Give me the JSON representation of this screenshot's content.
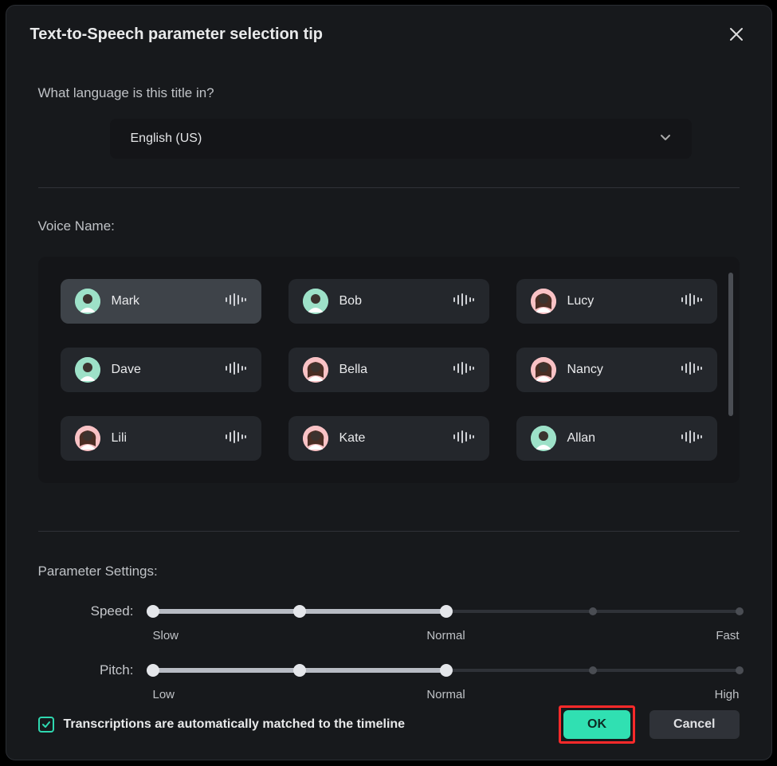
{
  "dialog": {
    "title": "Text-to-Speech parameter selection tip",
    "close_icon": "close"
  },
  "language": {
    "label": "What language is this title in?",
    "selected": "English (US)"
  },
  "voice": {
    "label": "Voice Name:",
    "selected_index": 0,
    "items": [
      {
        "name": "Mark",
        "avatar_color": "green",
        "gender": "m"
      },
      {
        "name": "Bob",
        "avatar_color": "green",
        "gender": "m"
      },
      {
        "name": "Lucy",
        "avatar_color": "pink",
        "gender": "f"
      },
      {
        "name": "Dave",
        "avatar_color": "green",
        "gender": "m"
      },
      {
        "name": "Bella",
        "avatar_color": "pink",
        "gender": "f"
      },
      {
        "name": "Nancy",
        "avatar_color": "pink",
        "gender": "f"
      },
      {
        "name": "Lili",
        "avatar_color": "pink",
        "gender": "f"
      },
      {
        "name": "Kate",
        "avatar_color": "pink",
        "gender": "f"
      },
      {
        "name": "Allan",
        "avatar_color": "green",
        "gender": "m"
      }
    ]
  },
  "parameters": {
    "label": "Parameter Settings:",
    "speed": {
      "name": "Speed:",
      "value": 50,
      "ticks": [
        "Slow",
        "Normal",
        "Fast"
      ]
    },
    "pitch": {
      "name": "Pitch:",
      "value": 50,
      "ticks": [
        "Low",
        "Normal",
        "High"
      ]
    }
  },
  "transcription": {
    "checked": true,
    "label": "Transcriptions are automatically matched to the timeline"
  },
  "buttons": {
    "ok": "OK",
    "cancel": "Cancel"
  }
}
